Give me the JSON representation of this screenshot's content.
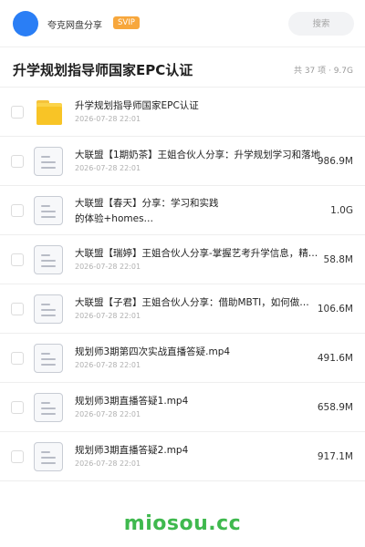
{
  "header": {
    "title": "夸克网盘分享",
    "badge": "SVIP",
    "search_placeholder": "搜索",
    "avatar_color": "#2a7ef5",
    "badge_color": "#f7a73c"
  },
  "folder": {
    "title": "升学规划指导师国家EPC认证",
    "meta": "共 37 项 · 9.7G"
  },
  "items": [
    {
      "icon": "folder-icon",
      "name": "升学规划指导师国家EPC认证",
      "date": "2026-07-28 22:01",
      "size": ""
    },
    {
      "icon": "document-icon",
      "name": "大联盟【1期奶茶】王姐合伙人分享：升学规划学习和落地",
      "date": "2026-07-28 22:01",
      "size": "986.9M"
    },
    {
      "icon": "document-icon",
      "name": "大联盟【春天】分享：学习和实践的体验+homes…",
      "date": "2026-07-28 22:01",
      "size": "1.0G"
    },
    {
      "icon": "document-icon",
      "name": "大联盟【瑞婷】王姐合伙人分享-掌握艺考升学信息，精准…",
      "date": "2026-07-28 22:01",
      "size": "58.8M"
    },
    {
      "icon": "document-icon",
      "name": "大联盟【子君】王姐合伙人分享：借助MBTI，如何做…",
      "date": "2026-07-28 22:01",
      "size": "106.6M"
    },
    {
      "icon": "document-icon",
      "name": "规划师3期第四次实战直播答疑.mp4",
      "date": "2026-07-28 22:01",
      "size": "491.6M"
    },
    {
      "icon": "document-icon",
      "name": "规划师3期直播答疑1.mp4",
      "date": "2026-07-28 22:01",
      "size": "658.9M"
    },
    {
      "icon": "document-icon",
      "name": "规划师3期直播答疑2.mp4",
      "date": "2026-07-28 22:01",
      "size": "917.1M"
    }
  ],
  "watermark": "miosou.cc"
}
